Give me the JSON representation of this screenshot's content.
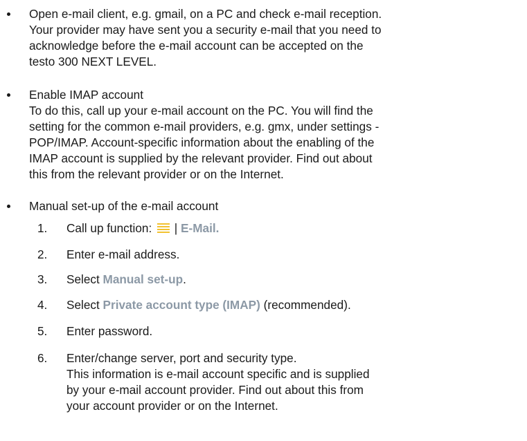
{
  "bullets": [
    {
      "lines": [
        "Open e-mail client, e.g. gmail, on a PC and check e-mail reception.",
        "Your provider may have sent you a security e-mail that you need to",
        "acknowledge before the e-mail account can be accepted on the",
        "testo 300 NEXT LEVEL."
      ]
    },
    {
      "lines": [
        "Enable IMAP account",
        "To do this, call up your e-mail account on the PC. You will find the",
        "setting for the common e-mail providers, e.g. gmx, under settings -",
        "POP/IMAP. Account-specific information about the enabling of the",
        "IMAP account is supplied by the relevant provider. Find out about",
        "this from the relevant provider or on the Internet."
      ]
    },
    {
      "lines": [
        "Manual set-up of the e-mail account"
      ]
    }
  ],
  "steps": [
    {
      "number": "1.",
      "pre": "Call up function: ",
      "icon": "menu-icon",
      "sep": " | ",
      "term": "E-Mail.",
      "post": ""
    },
    {
      "number": "2.",
      "text": "Enter e-mail address."
    },
    {
      "number": "3.",
      "pre": "Select ",
      "term": "Manual set-up",
      "post": "."
    },
    {
      "number": "4.",
      "pre": "Select ",
      "term": "Private account type (IMAP)",
      "post": " (recommended)."
    },
    {
      "number": "5.",
      "text": "Enter password."
    },
    {
      "number": "6.",
      "lines": [
        "Enter/change server, port and security type.",
        "This information is e-mail account specific and is supplied",
        "by your e-mail account provider. Find out about this from",
        "your account provider or on the Internet."
      ]
    }
  ],
  "colors": {
    "ui_term": "#8c99a6",
    "menu_icon": "#f2c230",
    "text": "#1a1a1a"
  }
}
